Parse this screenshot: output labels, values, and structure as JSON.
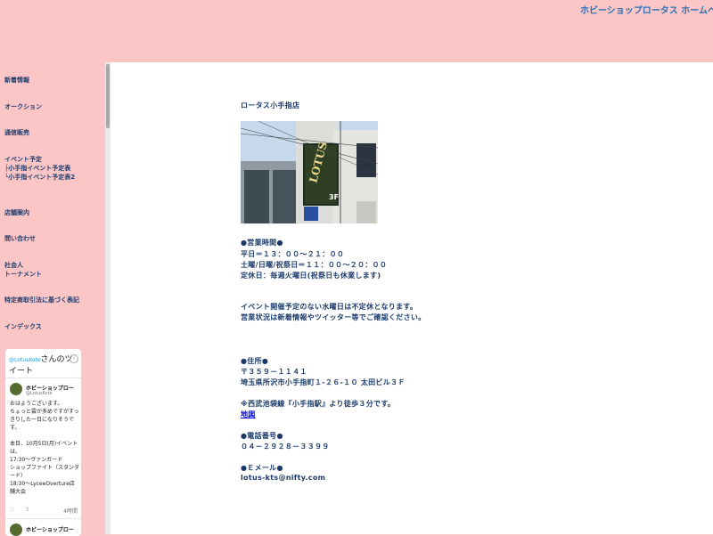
{
  "site_title": "ホビーショップロータス ホームページ",
  "nav": [
    "新着情報",
    "オークション",
    "通信販売",
    "イベント予定",
    "├小手指イベント予定表",
    "└小手指イベント予定表2",
    "店舗案内",
    "問い合わせ",
    "社会人",
    "トーナメント",
    "特定商取引法に基づく表記",
    "インデックス"
  ],
  "content": {
    "store_name": "ロータス小手指店",
    "photo_sign": "LOTUS",
    "photo_floor": "3F",
    "hours_heading": "●営業時間●",
    "weekday": "平日＝１３：００～２１：００",
    "weekend": "土曜/日曜/祝祭日＝１１：００～２０：００",
    "closed": "定休日：毎週火曜日(祝祭日も休業します)",
    "notice1": "イベント開催予定のない水曜日は不定休となります。",
    "notice2": "営業状況は新着情報やツイッター等でご確認ください。",
    "address_heading": "●住所●",
    "postal": "〒３５９－１１４１",
    "address": "埼玉県所沢市小手指町１-２６-１０ 太田ビル３Ｆ",
    "access": "※西武池袋線『小手指駅』より徒歩３分です。",
    "map_link": "地図",
    "phone_heading": "●電話番号●",
    "phone": "０４－２９２８－３３９９",
    "email_heading": "●Ｅメール●",
    "email": "lotus-kts@nifty.com"
  },
  "twitter": {
    "header_at": "@LotusKote",
    "header_rest": "さんのツイート",
    "tweet1": {
      "name": "ホビーショップロー",
      "handle": "@LotusKote",
      "text": "おはようございます。\nちょっと雲が多めですがすっきりした一日になりそうです。\n\n本日、10月5日(月)イベントは、\n17:30～ヴァンガード\nショップファイト（スタンダード）\n18:30～LyceeOverture店舗大会",
      "time": "4時間"
    },
    "tweet2": {
      "name": "ホビーショップロー"
    }
  },
  "colors": {
    "background": "#fdc6c6",
    "text": "#1a3a6b",
    "link": "#0000ee"
  }
}
